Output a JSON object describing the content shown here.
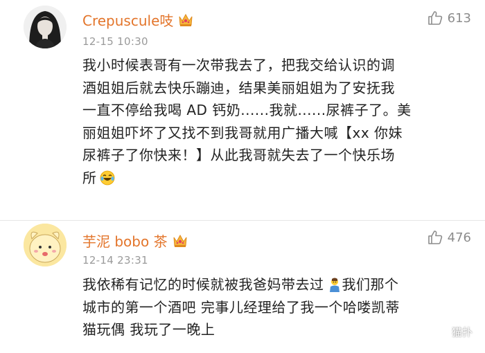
{
  "comments": [
    {
      "username": "Crepuscule吱",
      "timestamp": "12-15 10:30",
      "likes": "613",
      "content_lines": [
        "我小时候表哥有一次带我去了，把我交给认识的调",
        "酒姐姐后就去快乐蹦迪，结果美丽姐姐为了安抚我",
        "一直不停给我喝 AD 钙奶......我就......尿裤子了。美",
        "丽姐姐吓坏了又找不到我哥就用广播大喊【xx 你妹",
        "尿裤子了你快来！】从此我哥就失去了一个快乐场",
        "所"
      ],
      "avatar_icon": "portrait-avatar",
      "badge_icon": "crown-icon",
      "end_emoji": "laughing-crying-emoji"
    },
    {
      "username": "芋泥 bobo 茶",
      "timestamp": "12-14 23:31",
      "likes": "476",
      "content_lines": [
        "我依稀有记忆的时候就被我爸妈带去过",
        "城市的第一个酒吧 完事儿经理给了我一个哈喽凯蒂",
        "猫玩偶 我玩了一晚上"
      ],
      "line1_suffix": "我们那个",
      "avatar_icon": "cardcaptor-avatar",
      "badge_icon": "crown-icon",
      "inline_emoji": "shrug-emoji"
    }
  ],
  "watermark": {
    "text": "猫扑",
    "icon": "wechat-icon"
  },
  "colors": {
    "username": "#e3752b",
    "timestamp": "#9a9a9a",
    "content": "#222222",
    "crown": "#f5b63b"
  }
}
